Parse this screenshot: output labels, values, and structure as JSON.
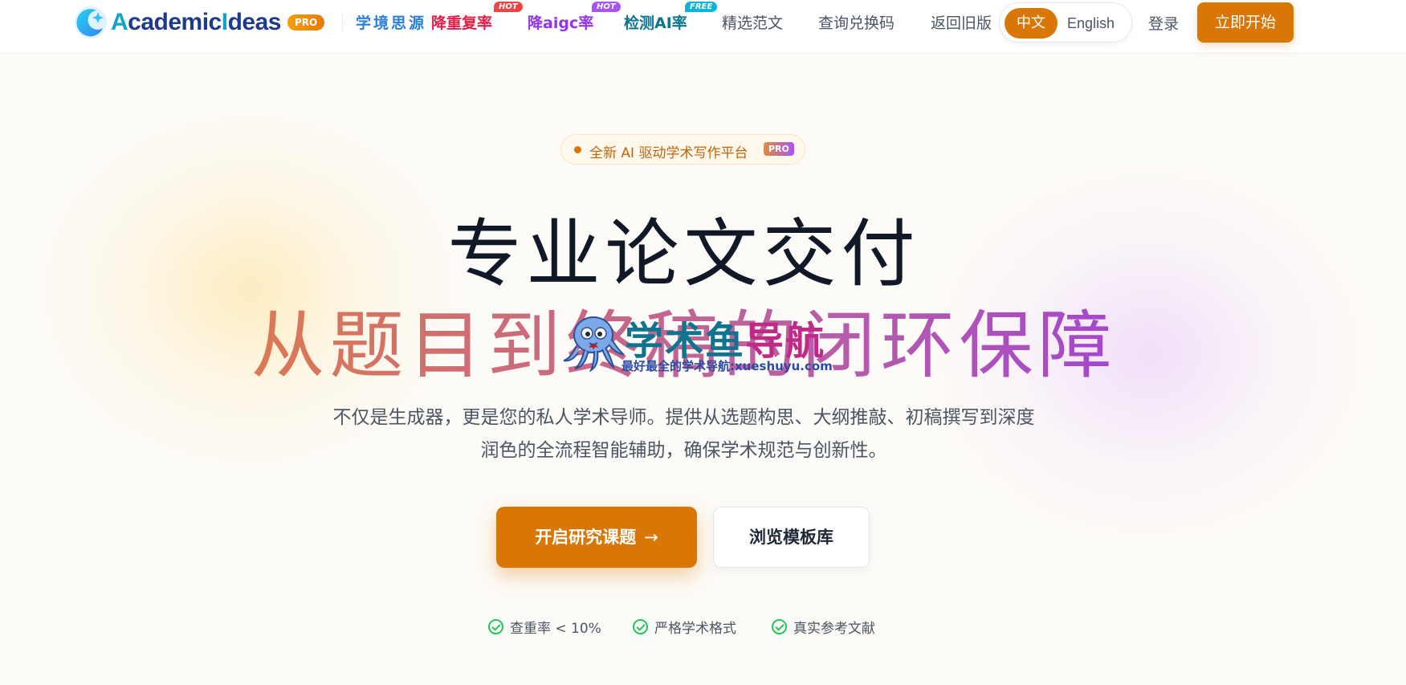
{
  "nav": {
    "logo": {
      "name_a": "A",
      "name_mid": "cademic",
      "name_i": "I",
      "name_end": "deas",
      "pro": "PRO"
    },
    "links": [
      {
        "label": "学境思源",
        "color": "#2b7fd6",
        "tag": ""
      },
      {
        "label": "降重复率",
        "color": "#e11d48",
        "tag": "HOT",
        "tag_color": "#ef4444"
      },
      {
        "label": "降aigc率",
        "color": "#9333ea",
        "tag": "HOT",
        "tag_color": "#a855f7"
      },
      {
        "label": "检测AI率",
        "color": "#0e7490",
        "tag": "FREE",
        "tag_color": "#06b6d4"
      },
      {
        "label": "精选范文"
      },
      {
        "label": "查询兑换码"
      },
      {
        "label": "返回旧版"
      }
    ],
    "lang": {
      "zh": "中文",
      "en": "English",
      "active": "zh"
    },
    "login": "登录",
    "start": "立即开始"
  },
  "hero": {
    "badge": "全新 AI 驱动学术写作平台",
    "badge_pro": "PRO",
    "title_line1": "专业论文交付",
    "title_line2": "从题目到终稿的闭环保障",
    "desc_line1": "不仅是生成器，更是您的私人学术导师。提供从选题构思、大纲推敲、初稿撰写到深度",
    "desc_line2": "润色的全流程智能辅助，确保学术规范与创新性。",
    "primary_button": "开启研究课题",
    "secondary_button": "浏览模板库",
    "features": [
      "查重率 < 10%",
      "严格学术格式",
      "真实参考文献"
    ]
  },
  "watermark": {
    "title_part1": "学术鱼",
    "title_part2": "导航",
    "subtitle": "最好最全的学术导航:xueshuyu.com"
  },
  "colors": {
    "accent": "#d97706",
    "check": "#22c55e"
  }
}
